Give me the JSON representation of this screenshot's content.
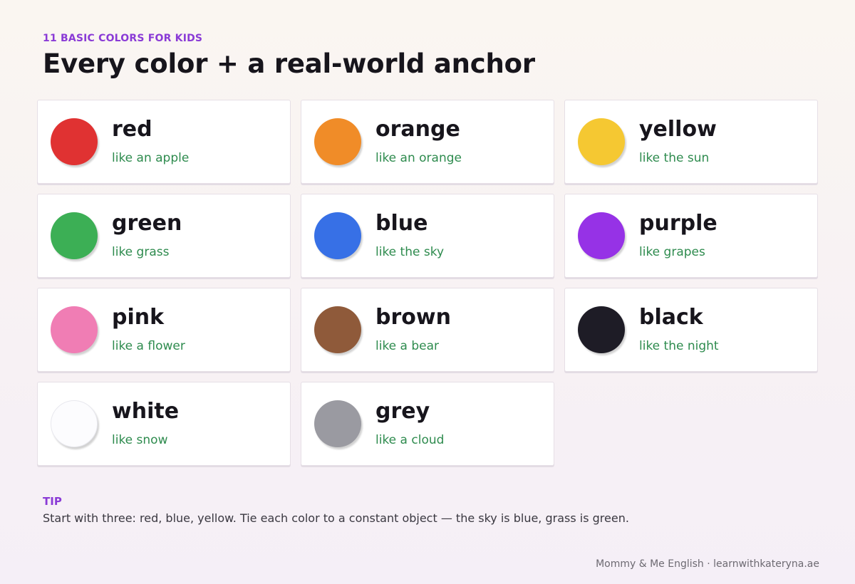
{
  "header": {
    "eyebrow": "11 BASIC COLORS FOR KIDS",
    "title": "Every color + a real-world anchor"
  },
  "colors": [
    {
      "name": "red",
      "anchor": "like an apple",
      "swatch": "#e03232"
    },
    {
      "name": "orange",
      "anchor": "like an orange",
      "swatch": "#f08c28"
    },
    {
      "name": "yellow",
      "anchor": "like the sun",
      "swatch": "#f5c832"
    },
    {
      "name": "green",
      "anchor": "like grass",
      "swatch": "#3caf55"
    },
    {
      "name": "blue",
      "anchor": "like the sky",
      "swatch": "#3770e6"
    },
    {
      "name": "purple",
      "anchor": "like grapes",
      "swatch": "#9632e6"
    },
    {
      "name": "pink",
      "anchor": "like a flower",
      "swatch": "#f07db4"
    },
    {
      "name": "brown",
      "anchor": "like a bear",
      "swatch": "#8f5a3a"
    },
    {
      "name": "black",
      "anchor": "like the night",
      "swatch": "#1e1c26"
    },
    {
      "name": "white",
      "anchor": "like snow",
      "swatch": "#fcfcfe"
    },
    {
      "name": "grey",
      "anchor": "like a cloud",
      "swatch": "#9a9aa1"
    }
  ],
  "tip": {
    "label": "TIP",
    "text": "Start with three: red, blue, yellow. Tie each color to a constant object — the sky is blue, grass is green."
  },
  "footer": {
    "text": "Mommy & Me English · learnwithkateryna.ae"
  },
  "theme": {
    "accent": "#8a3bd6",
    "anchor_text": "#2e8b4e",
    "heading_text": "#17151c"
  }
}
